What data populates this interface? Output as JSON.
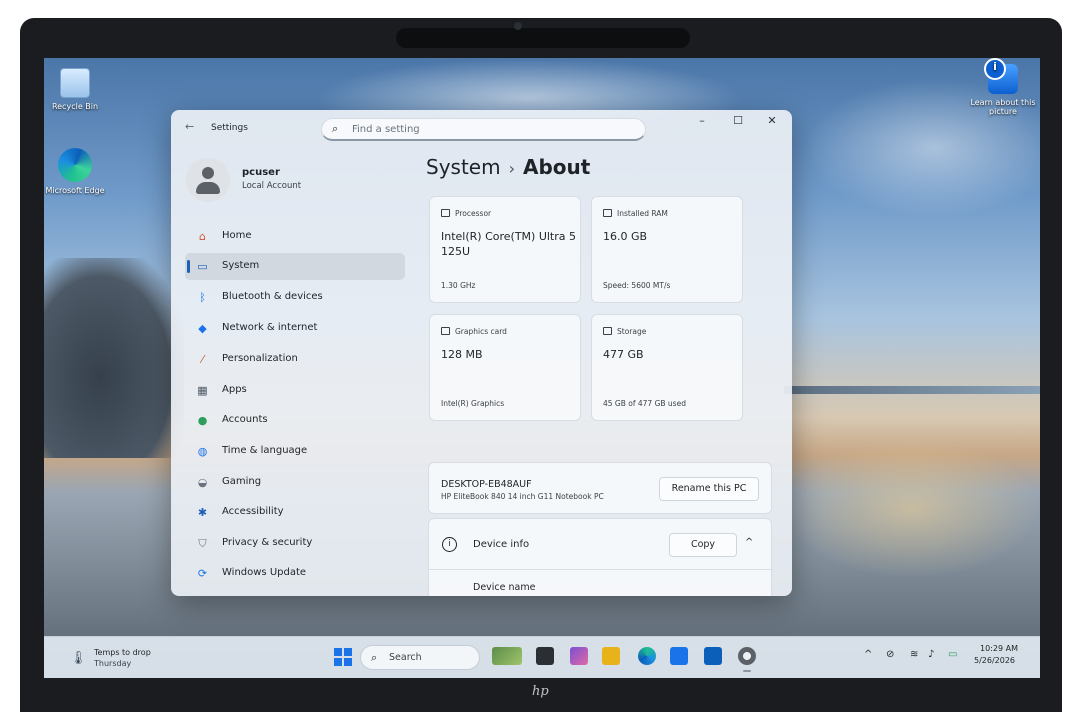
{
  "desktop": {
    "icons": [
      {
        "label": "Recycle Bin",
        "icon": "recycle-bin-icon"
      },
      {
        "label": "Microsoft Edge",
        "icon": "edge-icon"
      },
      {
        "label": "Learn about this picture",
        "icon": "spotlight-info-icon"
      }
    ]
  },
  "settings": {
    "app_title": "Settings",
    "search_placeholder": "Find a setting",
    "window_controls": {
      "minimize": "–",
      "maximize": "☐",
      "close": "✕"
    },
    "profile": {
      "name": "pcuser",
      "account_type": "Local Account"
    },
    "nav": [
      {
        "label": "Home",
        "icon": "home-icon",
        "color": "#d2553a"
      },
      {
        "label": "System",
        "icon": "system-icon",
        "color": "#1f5fb6",
        "active": true
      },
      {
        "label": "Bluetooth & devices",
        "icon": "bluetooth-icon",
        "color": "#1a73e8"
      },
      {
        "label": "Network & internet",
        "icon": "network-icon",
        "color": "#1a73e8"
      },
      {
        "label": "Personalization",
        "icon": "brush-icon",
        "color": "#c2612a"
      },
      {
        "label": "Apps",
        "icon": "apps-icon",
        "color": "#4b5563"
      },
      {
        "label": "Accounts",
        "icon": "accounts-icon",
        "color": "#2e9e5b"
      },
      {
        "label": "Time & language",
        "icon": "globe-icon",
        "color": "#1a73e8"
      },
      {
        "label": "Gaming",
        "icon": "gamepad-icon",
        "color": "#6b7280"
      },
      {
        "label": "Accessibility",
        "icon": "accessibility-icon",
        "color": "#1f5fb6"
      },
      {
        "label": "Privacy & security",
        "icon": "shield-icon",
        "color": "#6b7280"
      },
      {
        "label": "Windows Update",
        "icon": "windows-update-icon",
        "color": "#1a73e8"
      }
    ],
    "page": {
      "parent": "System",
      "separator": "›",
      "current": "About"
    },
    "specs": [
      {
        "title": "Processor",
        "value": "Intel(R) Core(TM) Ultra 5 125U",
        "detail": "1.30 GHz"
      },
      {
        "title": "Installed RAM",
        "value": "16.0 GB",
        "detail": "Speed: 5600 MT/s"
      },
      {
        "title": "Graphics card",
        "value": "128 MB",
        "detail": "Intel(R) Graphics"
      },
      {
        "title": "Storage",
        "value": "477 GB",
        "detail": "45 GB of 477 GB used"
      }
    ],
    "pc": {
      "name": "DESKTOP-EB48AUF",
      "model": "HP EliteBook 840 14 inch G11 Notebook PC",
      "rename_label": "Rename this PC"
    },
    "device_info": {
      "title": "Device info",
      "copy_label": "Copy",
      "chevron": "^",
      "first_row": "Device name"
    }
  },
  "taskbar": {
    "weather_line1": "Temps to drop",
    "weather_line2": "Thursday",
    "search_placeholder": "Search",
    "apps": [
      {
        "name": "widgets-icon",
        "color": "#5c8d4a"
      },
      {
        "name": "task-view-icon",
        "color": "#2b2f33"
      },
      {
        "name": "copilot-icon",
        "color": "#7a4fd1"
      },
      {
        "name": "file-explorer-icon",
        "color": "#e8b21b"
      },
      {
        "name": "edge-taskbar-icon",
        "color": "#1a8fe0"
      },
      {
        "name": "store-icon",
        "color": "#1a73e8"
      },
      {
        "name": "outlook-icon",
        "color": "#0c5fb8"
      },
      {
        "name": "settings-taskbar-icon",
        "color": "#5c6168"
      }
    ],
    "tray": {
      "chevron": "^",
      "time": "10:29 AM",
      "date": "5/26/2026"
    }
  },
  "device_logo": "hp"
}
